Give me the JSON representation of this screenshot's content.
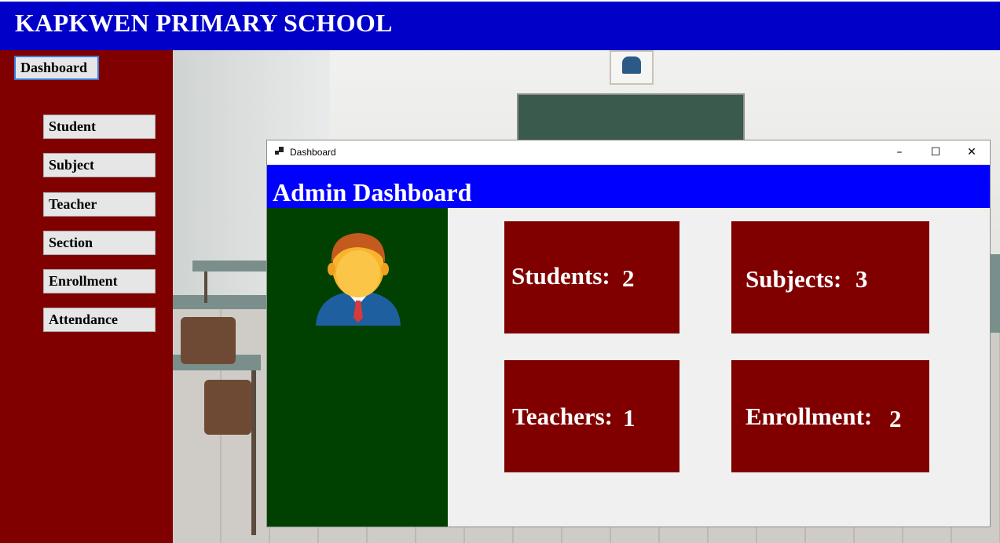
{
  "app": {
    "title": "KAPKWEN PRIMARY SCHOOL"
  },
  "sidebar": {
    "dashboard_label": "Dashboard",
    "items": [
      {
        "label": "Student"
      },
      {
        "label": "Subject"
      },
      {
        "label": "Teacher"
      },
      {
        "label": "Section"
      },
      {
        "label": "Enrollment"
      },
      {
        "label": "Attendance"
      }
    ]
  },
  "window": {
    "title": "Dashboard",
    "controls": {
      "minimize": "–",
      "maximize": "☐",
      "close": "✕"
    },
    "icons": {
      "app": "window-app-icon",
      "avatar": "admin-avatar-icon"
    }
  },
  "dashboard": {
    "heading": "Admin Dashboard",
    "cards": [
      {
        "label": "Students:",
        "value": "2"
      },
      {
        "label": "Subjects:",
        "value": "3"
      },
      {
        "label": "Teachers:",
        "value": "1"
      },
      {
        "label": "Enrollment:",
        "value": "2"
      }
    ]
  },
  "colors": {
    "topbar": "#0000c8",
    "sidebar": "#800000",
    "header_band": "#0000ff",
    "green_panel": "#004000",
    "card": "#800000"
  }
}
